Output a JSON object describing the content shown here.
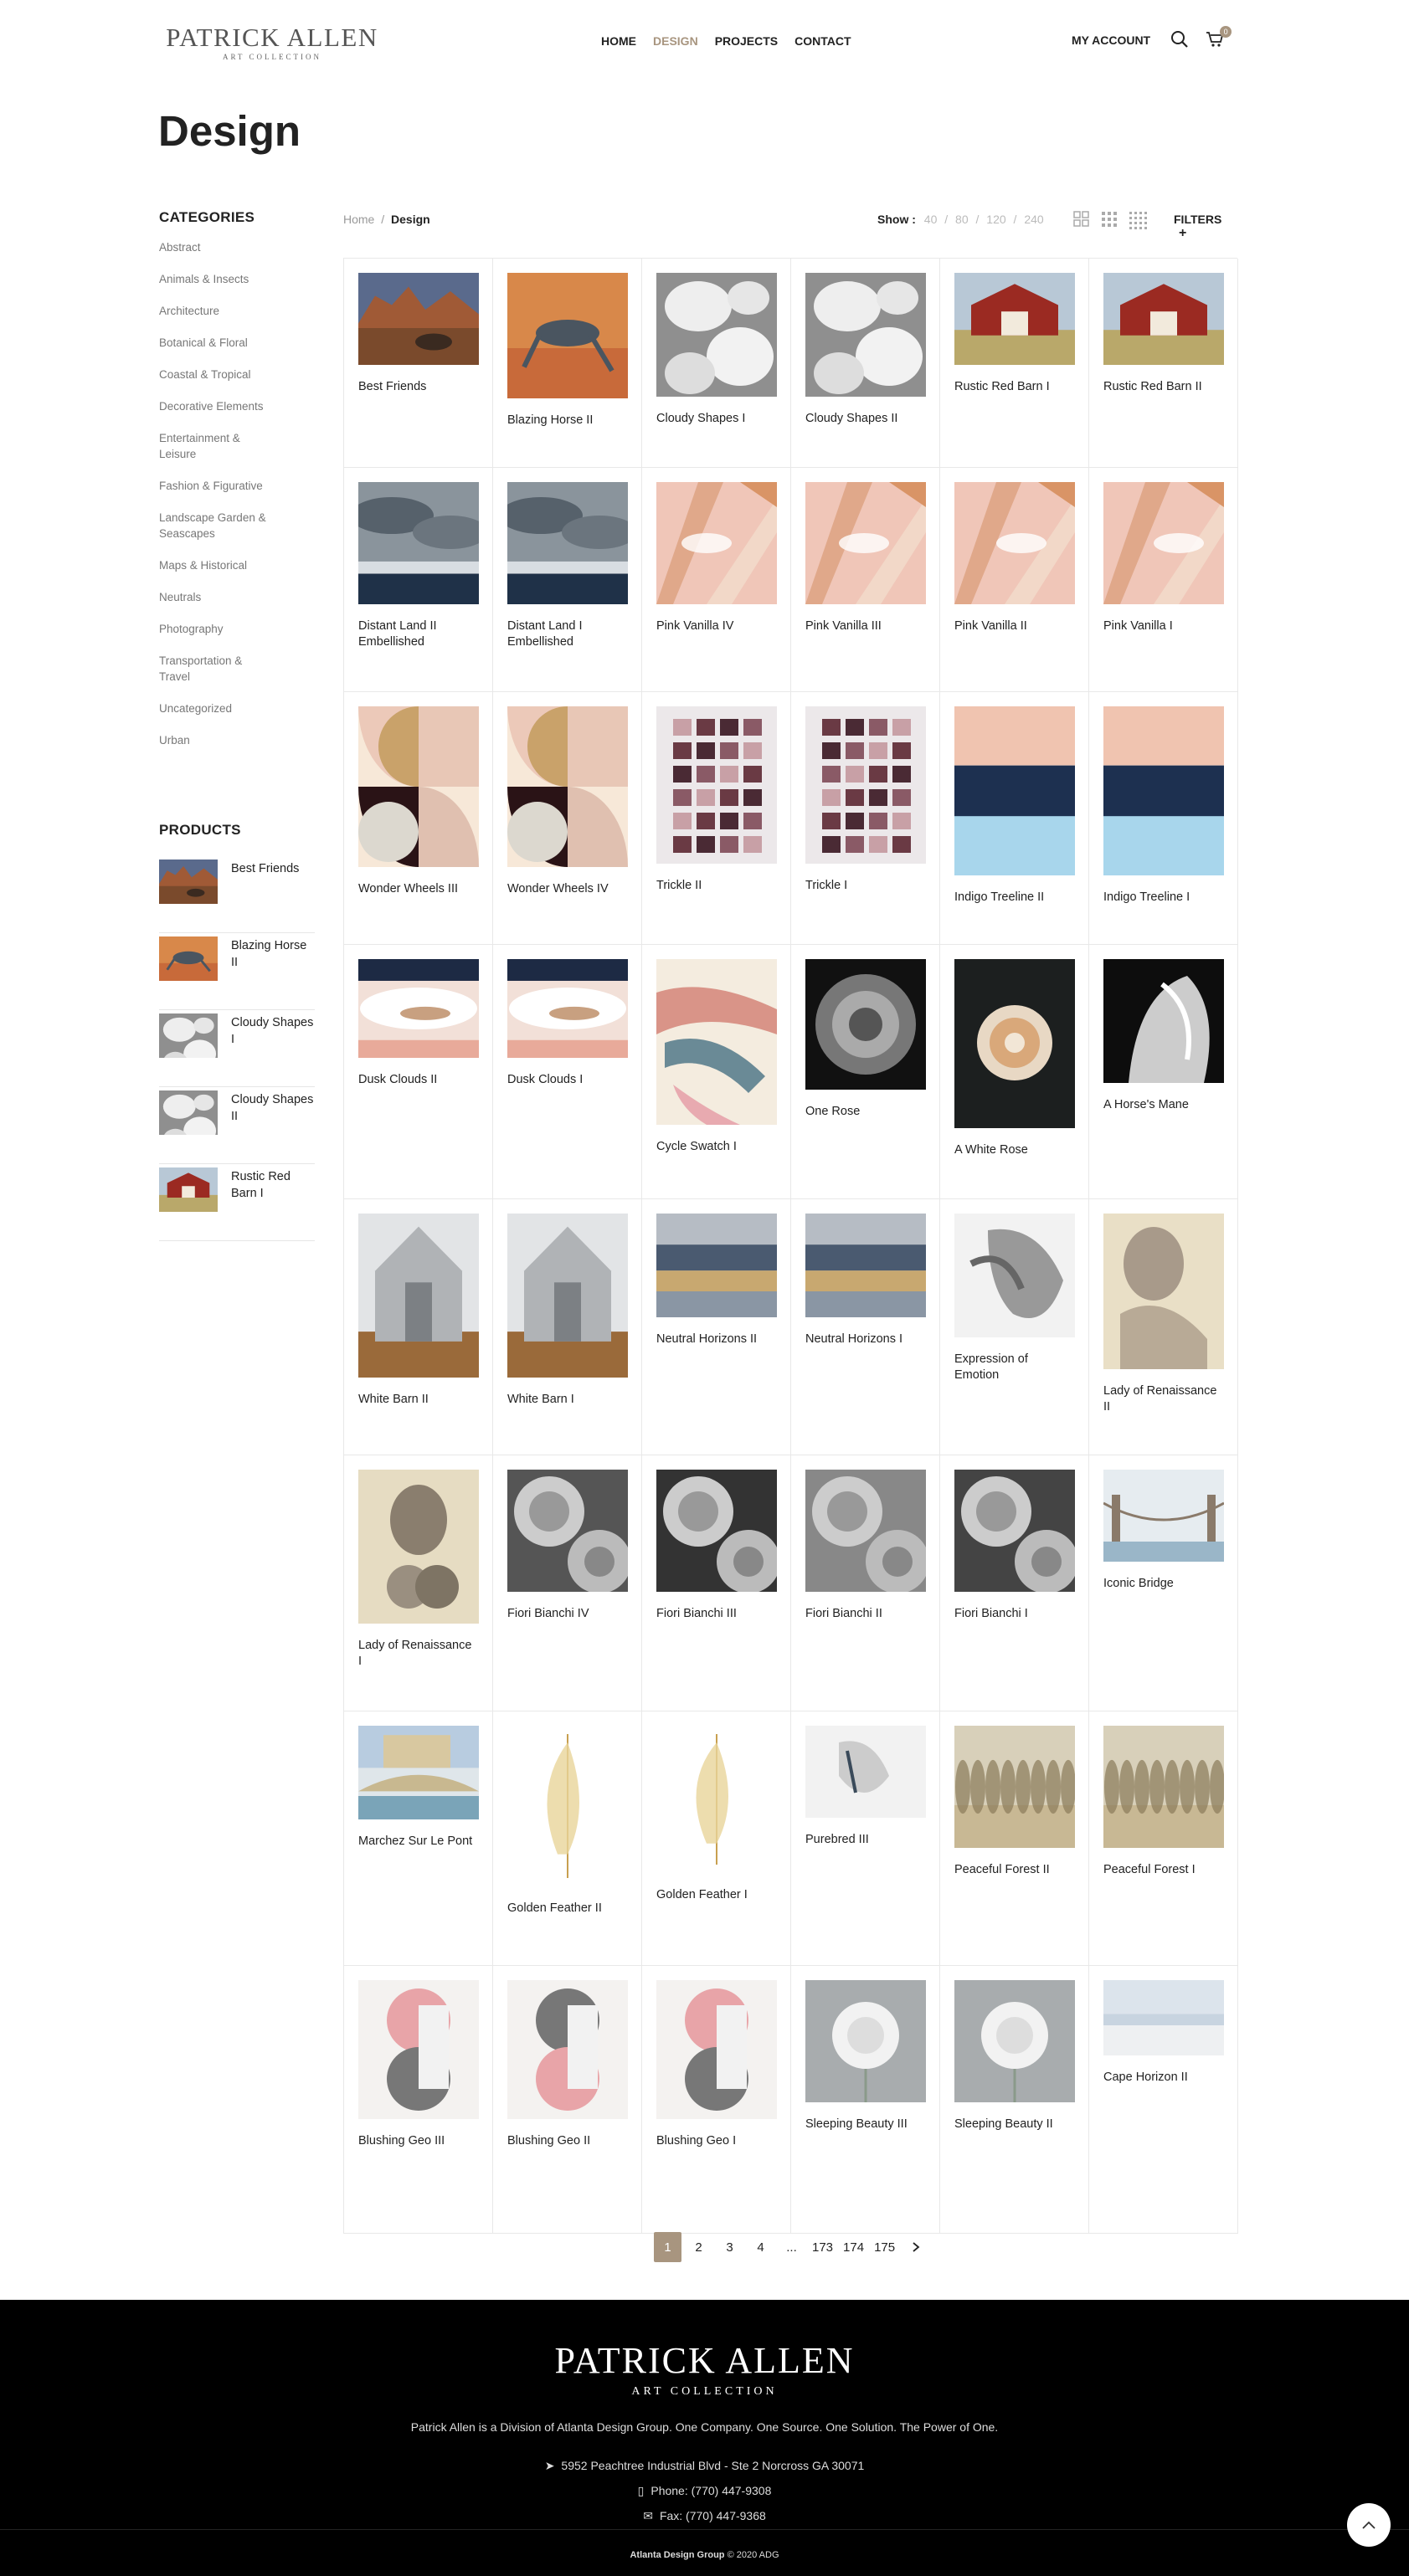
{
  "header": {
    "logo_main": "PATRICK ALLEN",
    "logo_sub": "ART COLLECTION",
    "nav": [
      "HOME",
      "DESIGN",
      "PROJECTS",
      "CONTACT"
    ],
    "active_nav": "DESIGN",
    "my_account": "MY ACCOUNT",
    "cart_count": "0",
    "accent": "#a8957f"
  },
  "page": {
    "title": "Design"
  },
  "sidebar": {
    "categories_heading": "CATEGORIES",
    "categories": [
      "Abstract",
      "Animals & Insects",
      "Architecture",
      "Botanical & Floral",
      "Coastal & Tropical",
      "Decorative Elements",
      "Entertainment & Leisure",
      "Fashion & Figurative",
      "Landscape Garden & Seascapes",
      "Maps & Historical",
      "Neutrals",
      "Photography",
      "Transportation & Travel",
      "Uncategorized",
      "Urban"
    ],
    "products_heading": "PRODUCTS",
    "products": [
      "Best Friends",
      "Blazing Horse II",
      "Cloudy Shapes I",
      "Cloudy Shapes II",
      "Rustic Red Barn I"
    ]
  },
  "toolbar": {
    "breadcrumb_home": "Home",
    "breadcrumb_sep": "/",
    "breadcrumb_current": "Design",
    "show_label": "Show :",
    "show_options": [
      "40",
      "80",
      "120",
      "240"
    ],
    "filters": "FILTERS"
  },
  "products": [
    [
      "Best Friends",
      "Blazing Horse II",
      "Cloudy Shapes I",
      "Cloudy Shapes II",
      "Rustic Red Barn I",
      "Rustic Red Barn II"
    ],
    [
      "Distant Land II Embellished",
      "Distant Land I Embellished",
      "Pink Vanilla IV",
      "Pink Vanilla III",
      "Pink Vanilla II",
      "Pink Vanilla I"
    ],
    [
      "Wonder Wheels III",
      "Wonder Wheels IV",
      "Trickle II",
      "Trickle I",
      "Indigo Treeline II",
      "Indigo Treeline I"
    ],
    [
      "Dusk Clouds II",
      "Dusk Clouds I",
      "Cycle Swatch I",
      "One Rose",
      "A White Rose",
      "A Horse's Mane"
    ],
    [
      "White Barn II",
      "White Barn I",
      "Neutral Horizons II",
      "Neutral Horizons I",
      "Expression of Emotion",
      "Lady of Renaissance II"
    ],
    [
      "Lady of Renaissance I",
      "Fiori Bianchi IV",
      "Fiori Bianchi III",
      "Fiori Bianchi II",
      "Fiori Bianchi I",
      "Iconic Bridge"
    ],
    [
      "Marchez Sur Le Pont",
      "Golden Feather II",
      "Golden Feather I",
      "Purebred III",
      "Peaceful Forest II",
      "Peaceful Forest I"
    ],
    [
      "Blushing Geo III",
      "Blushing Geo II",
      "Blushing Geo I",
      "Sleeping Beauty III",
      "Sleeping Beauty II",
      "Cape Horizon II"
    ]
  ],
  "pagination": [
    "1",
    "2",
    "3",
    "4",
    "...",
    "173",
    "174",
    "175"
  ],
  "footer": {
    "logo_main": "PATRICK ALLEN",
    "logo_sub": "ART COLLECTION",
    "tagline": "Patrick Allen is a Division of Atlanta Design Group. One Company. One Source. One Solution. The Power of One.",
    "address": "5952 Peachtree Industrial Blvd - Ste 2 Norcross GA 30071",
    "phone": "Phone: (770) 447-9308",
    "fax": "Fax: (770) 447-9368",
    "copyright_company": "Atlanta Design Group",
    "copyright_rest": " © 2020 ADG"
  }
}
